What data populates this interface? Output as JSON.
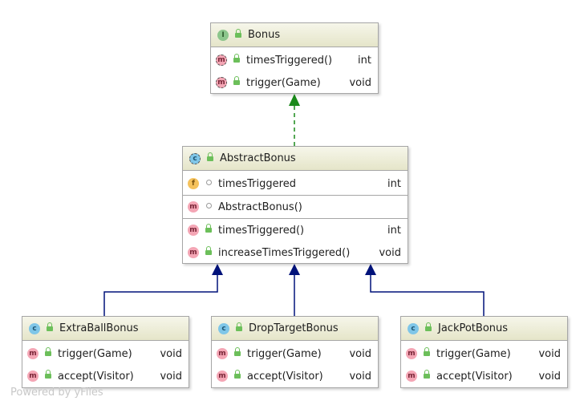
{
  "bonus": {
    "title": "Bonus",
    "methods": [
      {
        "name": "timesTriggered()",
        "type": "int"
      },
      {
        "name": "trigger(Game)",
        "type": "void"
      }
    ]
  },
  "abstract_bonus": {
    "title": "AbstractBonus",
    "fields": [
      {
        "name": "timesTriggered",
        "type": "int"
      }
    ],
    "constructors": [
      {
        "name": "AbstractBonus()"
      }
    ],
    "methods": [
      {
        "name": "timesTriggered()",
        "type": "int"
      },
      {
        "name": "increaseTimesTriggered()",
        "type": "void"
      }
    ]
  },
  "extra_ball_bonus": {
    "title": "ExtraBallBonus",
    "methods": [
      {
        "name": "trigger(Game)",
        "type": "void"
      },
      {
        "name": "accept(Visitor)",
        "type": "void"
      }
    ]
  },
  "drop_target_bonus": {
    "title": "DropTargetBonus",
    "methods": [
      {
        "name": "trigger(Game)",
        "type": "void"
      },
      {
        "name": "accept(Visitor)",
        "type": "void"
      }
    ]
  },
  "jackpot_bonus": {
    "title": "JackPotBonus",
    "methods": [
      {
        "name": "trigger(Game)",
        "type": "void"
      },
      {
        "name": "accept(Visitor)",
        "type": "void"
      }
    ]
  },
  "badges": {
    "interface": "I",
    "class": "c",
    "method": "m",
    "field": "f"
  },
  "colors": {
    "realization": "#1a8a1a",
    "inheritance": "#00127a"
  },
  "watermark": "Powered by yFiles"
}
